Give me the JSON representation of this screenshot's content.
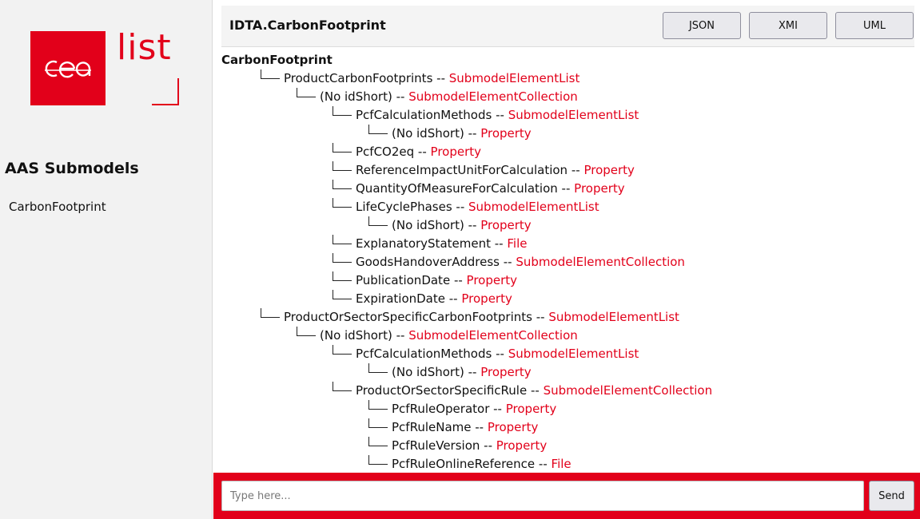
{
  "brand": {
    "logo_mark": "cea",
    "logo_word": "list",
    "accent_color": "#e2001a"
  },
  "sidebar": {
    "heading": "AAS Submodels",
    "items": [
      {
        "label": "CarbonFootprint"
      }
    ]
  },
  "header": {
    "title": "IDTA.CarbonFootprint",
    "buttons": {
      "json": "JSON",
      "xmi": "XMI",
      "uml": "UML"
    }
  },
  "tree": {
    "root": "CarbonFootprint",
    "separator": " -- ",
    "nodes": [
      {
        "depth": 1,
        "name": "ProductCarbonFootprints",
        "type": "SubmodelElementList"
      },
      {
        "depth": 2,
        "name": "(No idShort)",
        "type": "SubmodelElementCollection"
      },
      {
        "depth": 3,
        "name": "PcfCalculationMethods",
        "type": "SubmodelElementList"
      },
      {
        "depth": 4,
        "name": "(No idShort)",
        "type": "Property"
      },
      {
        "depth": 3,
        "name": "PcfCO2eq",
        "type": "Property"
      },
      {
        "depth": 3,
        "name": "ReferenceImpactUnitForCalculation",
        "type": "Property"
      },
      {
        "depth": 3,
        "name": "QuantityOfMeasureForCalculation",
        "type": "Property"
      },
      {
        "depth": 3,
        "name": "LifeCyclePhases",
        "type": "SubmodelElementList"
      },
      {
        "depth": 4,
        "name": "(No idShort)",
        "type": "Property"
      },
      {
        "depth": 3,
        "name": "ExplanatoryStatement",
        "type": "File"
      },
      {
        "depth": 3,
        "name": "GoodsHandoverAddress",
        "type": "SubmodelElementCollection"
      },
      {
        "depth": 3,
        "name": "PublicationDate",
        "type": "Property"
      },
      {
        "depth": 3,
        "name": "ExpirationDate",
        "type": "Property"
      },
      {
        "depth": 1,
        "name": "ProductOrSectorSpecificCarbonFootprints",
        "type": "SubmodelElementList"
      },
      {
        "depth": 2,
        "name": "(No idShort)",
        "type": "SubmodelElementCollection"
      },
      {
        "depth": 3,
        "name": "PcfCalculationMethods",
        "type": "SubmodelElementList"
      },
      {
        "depth": 4,
        "name": "(No idShort)",
        "type": "Property"
      },
      {
        "depth": 3,
        "name": "ProductOrSectorSpecificRule",
        "type": "SubmodelElementCollection"
      },
      {
        "depth": 4,
        "name": "PcfRuleOperator",
        "type": "Property"
      },
      {
        "depth": 4,
        "name": "PcfRuleName",
        "type": "Property"
      },
      {
        "depth": 4,
        "name": "PcfRuleVersion",
        "type": "Property"
      },
      {
        "depth": 4,
        "name": "PcfRuleOnlineReference",
        "type": "File"
      }
    ]
  },
  "chat": {
    "placeholder": "Type here...",
    "send_label": "Send"
  }
}
